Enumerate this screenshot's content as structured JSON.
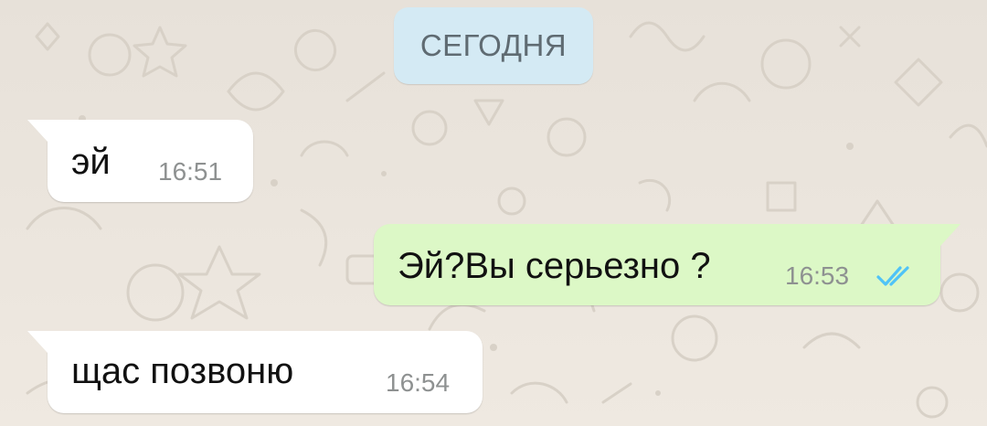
{
  "date_separator": "СЕГОДНЯ",
  "colors": {
    "background": "#ece5dd",
    "incoming_bubble": "#ffffff",
    "outgoing_bubble": "#dcf8c6",
    "date_chip": "#d4eaf4",
    "read_ticks": "#4fc3f7"
  },
  "messages": [
    {
      "direction": "incoming",
      "text": "эй",
      "time": "16:51"
    },
    {
      "direction": "outgoing",
      "text": "Эй?Вы серьезно ?",
      "time": "16:53",
      "status_icon": "double-check-read-icon"
    },
    {
      "direction": "incoming",
      "text": "щас позвоню",
      "time": "16:54"
    }
  ]
}
